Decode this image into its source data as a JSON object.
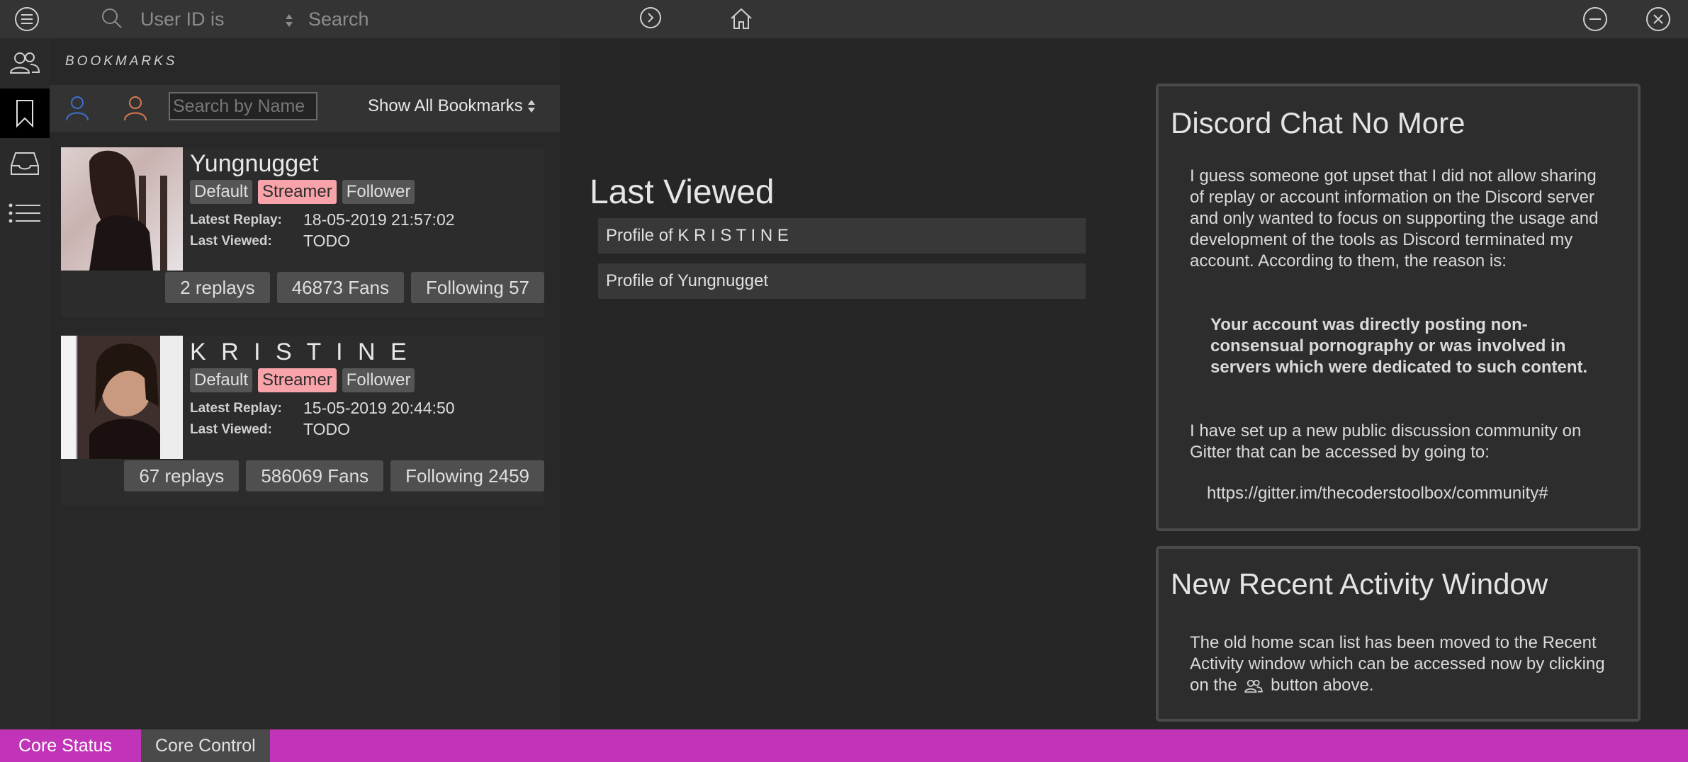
{
  "topbar": {
    "search_field_label": "User ID is",
    "search_placeholder": "Search"
  },
  "bookmarks": {
    "title": "BOOKMARKS",
    "search_placeholder": "Search by Name",
    "filter_selected": "Show All Bookmarks",
    "latest_replay_label": "Latest Replay:",
    "last_viewed_label": "Last Viewed:",
    "cards": [
      {
        "name": "Yungnugget",
        "tags": [
          "Default",
          "Streamer",
          "Follower"
        ],
        "latest_replay": "18-05-2019 21:57:02",
        "last_viewed": "TODO",
        "replays": "2 replays",
        "fans": "46873 Fans",
        "following": "Following 57"
      },
      {
        "name": "K R I S T I N E",
        "tags": [
          "Default",
          "Streamer",
          "Follower"
        ],
        "latest_replay": "15-05-2019 20:44:50",
        "last_viewed": "TODO",
        "replays": "67 replays",
        "fans": "586069 Fans",
        "following": "Following 2459"
      }
    ]
  },
  "last_viewed": {
    "title": "Last Viewed",
    "items": [
      "Profile of K R I S T I N E",
      "Profile of Yungnugget"
    ]
  },
  "news": [
    {
      "title": "Discord Chat No More",
      "p1": "I guess someone got upset that I did not allow sharing of replay or account information on the Discord server and only wanted to focus on supporting the usage and development of the tools as Discord terminated my account. According to them, the reason is:",
      "quote": "Your account was directly posting non-consensual pornography or was involved in servers which were dedicated to such content.",
      "p2": "I have set up a new public discussion community on Gitter that can be accessed by going to:",
      "link": "https://gitter.im/thecoderstoolbox/community#"
    },
    {
      "title": "New Recent Activity Window",
      "p1_before": "The old home scan list has been moved to the Recent Activity window which can be accessed now by clicking on the",
      "p1_after": "button above."
    }
  ],
  "bottombar": {
    "tabs": [
      "Core Status",
      "Core Control"
    ]
  },
  "colors": {
    "streamer_tag": "#f7a3a9",
    "status_bar": "#c134b8",
    "background": "#262626",
    "user_icon_blue": "#3d6fd1",
    "user_icon_orange": "#d97a52"
  }
}
